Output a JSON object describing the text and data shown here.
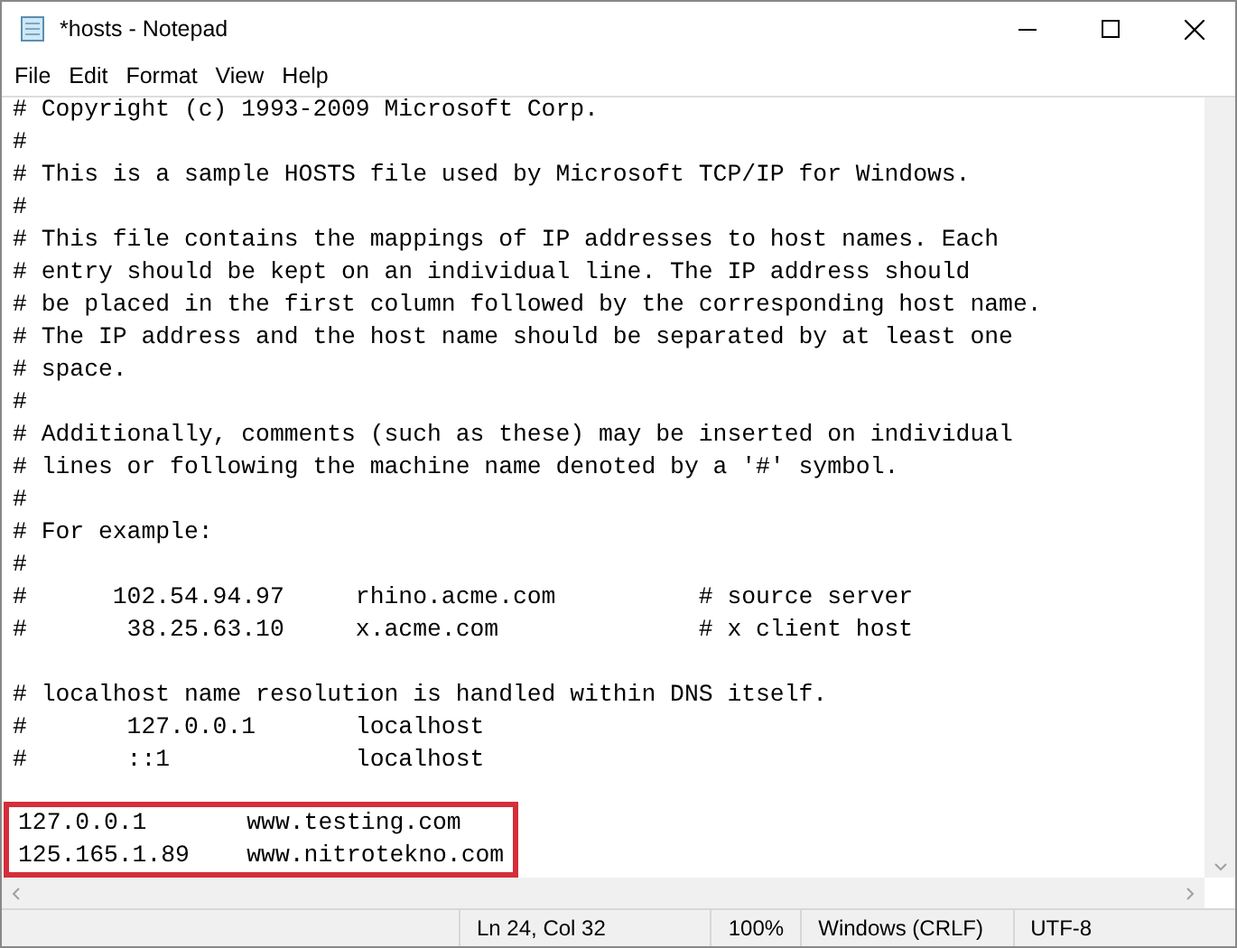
{
  "window": {
    "title": "*hosts - Notepad"
  },
  "menu": [
    "File",
    "Edit",
    "Format",
    "View",
    "Help"
  ],
  "editor": {
    "blocks": [
      [
        "# Copyright (c) 1993-2009 Microsoft Corp.",
        "#",
        "# This is a sample HOSTS file used by Microsoft TCP/IP for Windows.",
        "#",
        "# This file contains the mappings of IP addresses to host names. Each",
        "# entry should be kept on an individual line. The IP address should",
        "# be placed in the first column followed by the corresponding host name.",
        "# The IP address and the host name should be separated by at least one",
        "# space.",
        "#",
        "# Additionally, comments (such as these) may be inserted on individual",
        "# lines or following the machine name denoted by a '#' symbol.",
        "#",
        "# For example:",
        "#",
        "#      102.54.94.97     rhino.acme.com          # source server",
        "#       38.25.63.10     x.acme.com              # x client host"
      ],
      [
        "# localhost name resolution is handled within DNS itself.",
        "#       127.0.0.1       localhost",
        "#       ::1             localhost"
      ]
    ],
    "highlighted_lines": [
      "127.0.0.1       www.testing.com",
      "125.165.1.89    www.nitrotekno.com"
    ]
  },
  "status_bar": [
    "Ln 24, Col 32",
    "100%",
    "Windows (CRLF)",
    "UTF-8"
  ]
}
